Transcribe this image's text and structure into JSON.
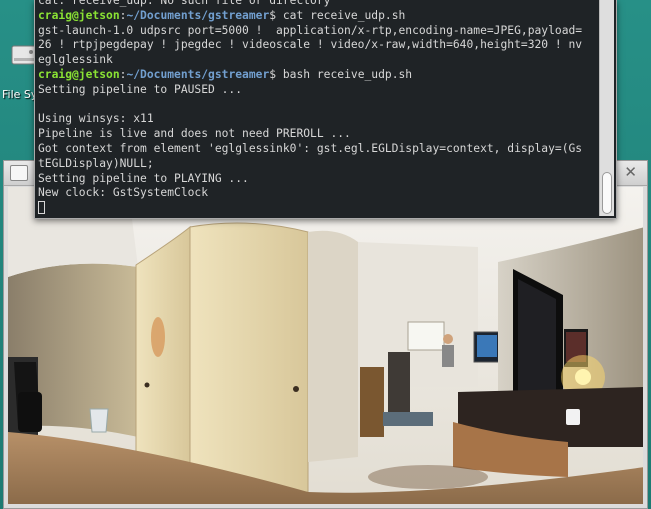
{
  "desktop": {
    "icon_label": "File Sy",
    "icon_name": "drive-icon"
  },
  "terminal": {
    "lines": [
      {
        "type": "text",
        "text": "cat: receive_udp: No such file or directory"
      },
      {
        "type": "prompt",
        "user": "craig@jetson",
        "sep": ":",
        "path": "~/Documents/gstreamer",
        "sym": "$",
        "cmd": " cat receive_udp.sh"
      },
      {
        "type": "text",
        "text": "gst-launch-1.0 udpsrc port=5000 !  application/x-rtp,encoding-name=JPEG,payload="
      },
      {
        "type": "text",
        "text": "26 ! rtpjpegdepay ! jpegdec ! videoscale ! video/x-raw,width=640,height=320 ! nv"
      },
      {
        "type": "text",
        "text": "eglglessink"
      },
      {
        "type": "prompt",
        "user": "craig@jetson",
        "sep": ":",
        "path": "~/Documents/gstreamer",
        "sym": "$",
        "cmd": " bash receive_udp.sh"
      },
      {
        "type": "text",
        "text": "Setting pipeline to PAUSED ..."
      },
      {
        "type": "text",
        "text": ""
      },
      {
        "type": "text",
        "text": "Using winsys: x11"
      },
      {
        "type": "text",
        "text": "Pipeline is live and does not need PREROLL ..."
      },
      {
        "type": "text",
        "text": "Got context from element 'eglglessink0': gst.egl.EGLDisplay=context, display=(Gs"
      },
      {
        "type": "text",
        "text": "tEGLDisplay)NULL;"
      },
      {
        "type": "text",
        "text": "Setting pipeline to PLAYING ..."
      },
      {
        "type": "text",
        "text": "New clock: GstSystemClock"
      },
      {
        "type": "cursor"
      }
    ]
  },
  "video_window": {
    "close_glyph": "✕",
    "content": "360-degree camera video stream"
  }
}
